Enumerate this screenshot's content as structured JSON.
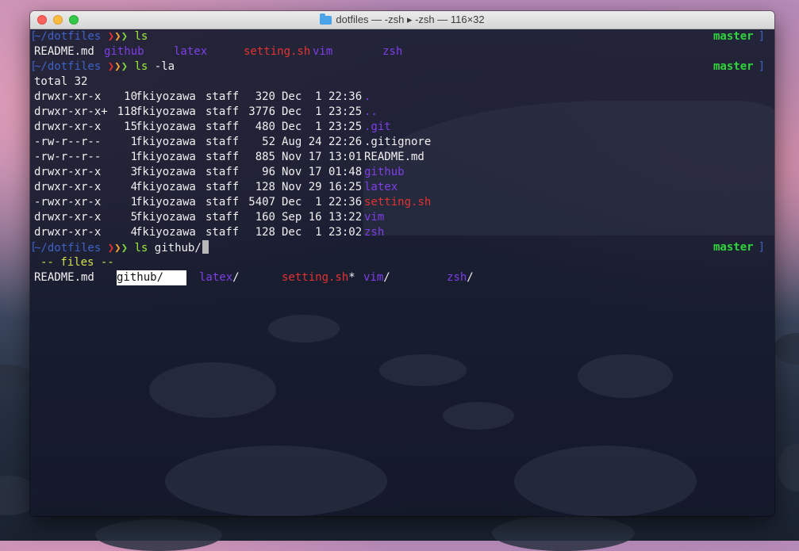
{
  "window": {
    "title": "dotfiles — -zsh ▸ -zsh — 116×32"
  },
  "prompt": {
    "dir": "~/dotfiles",
    "branch": "master"
  },
  "commands": {
    "c1": "ls",
    "c2": "ls",
    "c2_arg": "-la",
    "c3": "ls",
    "c3_arg": "github/"
  },
  "ls_output": {
    "readme": "README.md",
    "github": "github",
    "latex": "latex",
    "setting": "setting.sh",
    "vim": "vim",
    "zsh": "zsh"
  },
  "la_output": {
    "total": "total 32",
    "rows": [
      {
        "perm": "drwxr-xr-x",
        "links": "10",
        "owner": "fkiyozawa",
        "group": "staff",
        "size": "320",
        "date": "Dec  1 22:36",
        "name": "."
      },
      {
        "perm": "drwxr-xr-x+",
        "links": "118",
        "owner": "fkiyozawa",
        "group": "staff",
        "size": "3776",
        "date": "Dec  1 23:25",
        "name": ".."
      },
      {
        "perm": "drwxr-xr-x",
        "links": "15",
        "owner": "fkiyozawa",
        "group": "staff",
        "size": "480",
        "date": "Dec  1 23:25",
        "name": ".git"
      },
      {
        "perm": "-rw-r--r--",
        "links": "1",
        "owner": "fkiyozawa",
        "group": "staff",
        "size": "52",
        "date": "Aug 24 22:26",
        "name": ".gitignore"
      },
      {
        "perm": "-rw-r--r--",
        "links": "1",
        "owner": "fkiyozawa",
        "group": "staff",
        "size": "885",
        "date": "Nov 17 13:01",
        "name": "README.md"
      },
      {
        "perm": "drwxr-xr-x",
        "links": "3",
        "owner": "fkiyozawa",
        "group": "staff",
        "size": "96",
        "date": "Nov 17 01:48",
        "name": "github"
      },
      {
        "perm": "drwxr-xr-x",
        "links": "4",
        "owner": "fkiyozawa",
        "group": "staff",
        "size": "128",
        "date": "Nov 29 16:25",
        "name": "latex"
      },
      {
        "perm": "-rwxr-xr-x",
        "links": "1",
        "owner": "fkiyozawa",
        "group": "staff",
        "size": "5407",
        "date": "Dec  1 22:36",
        "name": "setting.sh"
      },
      {
        "perm": "drwxr-xr-x",
        "links": "5",
        "owner": "fkiyozawa",
        "group": "staff",
        "size": "160",
        "date": "Sep 16 13:22",
        "name": "vim"
      },
      {
        "perm": "drwxr-xr-x",
        "links": "4",
        "owner": "fkiyozawa",
        "group": "staff",
        "size": "128",
        "date": "Dec  1 23:02",
        "name": "zsh"
      }
    ]
  },
  "completion": {
    "header": "-- files --",
    "readme": "README.md",
    "github": "github",
    "latex": "latex",
    "setting": "setting.sh",
    "vim": "vim",
    "zsh": "zsh",
    "slash": "/",
    "star": "*"
  },
  "colors": {
    "prompt": "#3f62c8",
    "branch": "#2cd63a",
    "directory": "#7e3ee8",
    "executable": "#e5322f"
  }
}
